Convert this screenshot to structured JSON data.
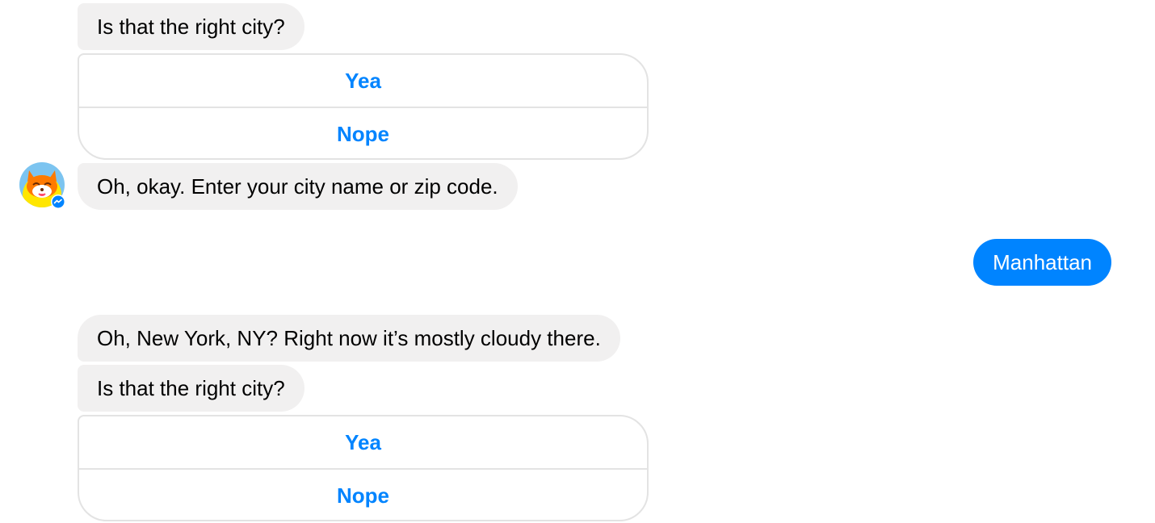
{
  "messages": {
    "m1": "Is that the right city?",
    "card1": {
      "yes": "Yea",
      "no": "Nope"
    },
    "m2": "Oh, okay. Enter your city name or zip code.",
    "user": "Manhattan",
    "m3": "Oh, New York, NY? Right now it’s mostly cloudy there.",
    "m4": "Is that the right city?",
    "card2": {
      "yes": "Yea",
      "no": "Nope"
    }
  },
  "avatar": {
    "icon": "bot-fox-avatar",
    "badge_icon": "messenger-icon"
  },
  "colors": {
    "accent": "#0084ff",
    "bot_bubble": "#f1f0f0",
    "card_border": "#e3e3e3",
    "avatar_bg": "#7cc4f0",
    "avatar_ring": "#ffe600",
    "fox": "#ff7a00"
  }
}
